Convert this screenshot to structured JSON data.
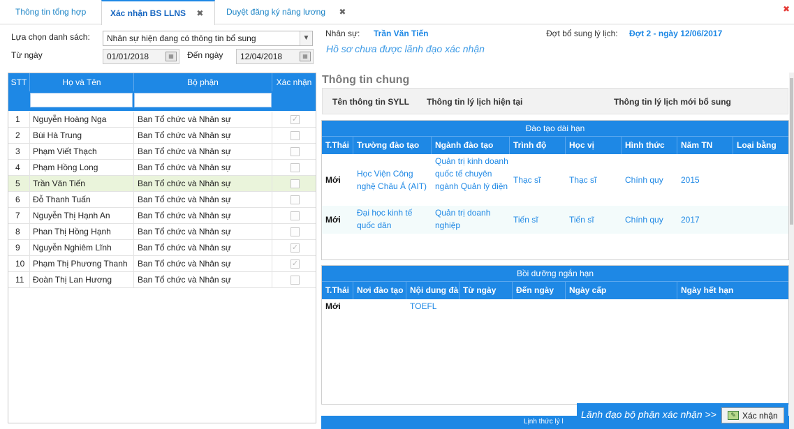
{
  "tabs": [
    {
      "label": "Thông tin tổng hợp"
    },
    {
      "label": "Xác nhận BS LLNS"
    },
    {
      "label": "Duyệt đăng ký nâng lương"
    }
  ],
  "filter": {
    "list_label": "Lựa chọn danh sách:",
    "list_value": "Nhân sự hiện đang có thông tin bổ sung",
    "from_label": "Từ ngày",
    "from_value": "01/01/2018",
    "to_label": "Đến ngày",
    "to_value": "12/04/2018"
  },
  "grid": {
    "headers": [
      "STT",
      "Họ và Tên",
      "Bộ phận",
      "Xác nhận"
    ],
    "rows": [
      {
        "stt": "1",
        "name": "Nguyễn Hoàng Nga",
        "dept": "Ban Tổ chức và Nhân sự",
        "confirmed": true
      },
      {
        "stt": "2",
        "name": "Bùi Hà Trung",
        "dept": "Ban Tổ chức và Nhân sự",
        "confirmed": false
      },
      {
        "stt": "3",
        "name": "Phạm Viết Thạch",
        "dept": "Ban Tổ chức và Nhân sự",
        "confirmed": false
      },
      {
        "stt": "4",
        "name": "Phạm Hồng Long",
        "dept": "Ban Tổ chức và Nhân sự",
        "confirmed": false
      },
      {
        "stt": "5",
        "name": "Trần Văn Tiến",
        "dept": "Ban Tổ chức và Nhân sự",
        "confirmed": false,
        "selected": true
      },
      {
        "stt": "6",
        "name": "Đỗ Thanh Tuấn",
        "dept": "Ban Tổ chức và Nhân sự",
        "confirmed": false
      },
      {
        "stt": "7",
        "name": "Nguyễn Thị Hạnh An",
        "dept": "Ban Tổ chức và Nhân sự",
        "confirmed": false
      },
      {
        "stt": "8",
        "name": "Phan Thị Hồng Hạnh",
        "dept": "Ban Tổ chức và Nhân sự",
        "confirmed": false
      },
      {
        "stt": "9",
        "name": "Nguyễn Nghiêm Lĩnh",
        "dept": "Ban Tổ chức và Nhân sự",
        "confirmed": true
      },
      {
        "stt": "10",
        "name": "Phạm Thị Phương Thanh",
        "dept": "Ban Tổ chức và Nhân sự",
        "confirmed": true
      },
      {
        "stt": "11",
        "name": "Đoàn Thị Lan Hương",
        "dept": "Ban Tổ chức và Nhân sự",
        "confirmed": false
      }
    ]
  },
  "info": {
    "staff_label": "Nhân sự:",
    "staff_value": "Trần Văn Tiến",
    "period_label": "Đợt bổ sung lý lịch:",
    "period_value": "Đợt 2 - ngày 12/06/2017",
    "status": "Hồ sơ chưa được lãnh đạo xác nhận"
  },
  "general": {
    "title": "Thông tin chung",
    "headers": [
      "Tên thông tin SYLL",
      "Thông tin lý lịch hiện tại",
      "Thông tin lý lịch mới bổ sung"
    ]
  },
  "long_training": {
    "title": "Đào tạo dài hạn",
    "headers": [
      "T.Thái",
      "Trường đào tạo",
      "Ngành đào tạo",
      "Trình độ",
      "Học vị",
      "Hình thức",
      "Năm TN",
      "Loại bằng"
    ],
    "rows": [
      {
        "status": "Mới",
        "school": "Học Viện Công nghệ Châu Á (AIT)",
        "major": "Quản trị kinh doanh quốc tế chuyên ngành Quản lý điện",
        "level": "Thạc sĩ",
        "degree": "Thạc sĩ",
        "form": "Chính quy",
        "year": "2015",
        "type": ""
      },
      {
        "status": "Mới",
        "school": "Đại học kinh tế quốc dân",
        "major": "Quản trị doanh nghiệp",
        "level": "Tiến sĩ",
        "degree": "Tiến sĩ",
        "form": "Chính quy",
        "year": "2017",
        "type": ""
      }
    ]
  },
  "short_training": {
    "title": "Bồi dưỡng ngắn hạn",
    "headers": [
      "T.Thái",
      "Nơi đào tạo",
      "Nội dung đào",
      "Từ ngày",
      "Đến ngày",
      "Ngày cấp",
      "Ngày hết hạn"
    ],
    "rows": [
      {
        "status": "Mới",
        "place": "",
        "content": "TOEFL",
        "from": "",
        "to": "",
        "issued": "",
        "expires": ""
      }
    ]
  },
  "footer_section": {
    "title": "Lịnh thức lý l"
  },
  "confirm": {
    "text": "Lãnh đạo bộ phận xác nhận >>",
    "button": "Xác nhận"
  }
}
